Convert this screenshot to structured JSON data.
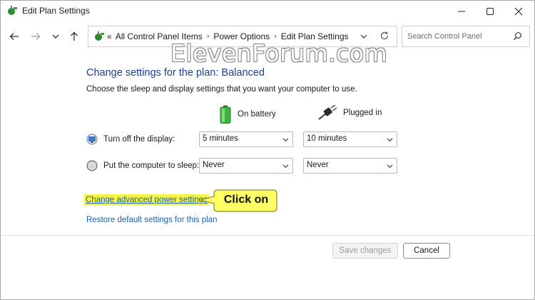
{
  "window": {
    "title": "Edit Plan Settings"
  },
  "address_bar": {
    "prefix": "«",
    "crumbs": [
      "All Control Panel Items",
      "Power Options",
      "Edit Plan Settings"
    ]
  },
  "search": {
    "placeholder": "Search Control Panel"
  },
  "watermark": "ElevenForum.com",
  "main": {
    "heading": "Change settings for the plan: Balanced",
    "subtitle": "Choose the sleep and display settings that you want your computer to use.",
    "columns": {
      "battery": "On battery",
      "plugged": "Plugged in"
    },
    "rows": [
      {
        "label": "Turn off the display:",
        "battery": "5 minutes",
        "plugged": "10 minutes"
      },
      {
        "label": "Put the computer to sleep:",
        "battery": "Never",
        "plugged": "Never"
      }
    ],
    "links": {
      "advanced": "Change advanced power settings",
      "restore": "Restore default settings for this plan"
    },
    "callout": "Click on"
  },
  "buttons": {
    "save": "Save changes",
    "cancel": "Cancel"
  },
  "colors": {
    "heading": "#1c3f94",
    "link": "#1a62b8",
    "highlight": "#f5f542",
    "callout": "#ffff66"
  }
}
